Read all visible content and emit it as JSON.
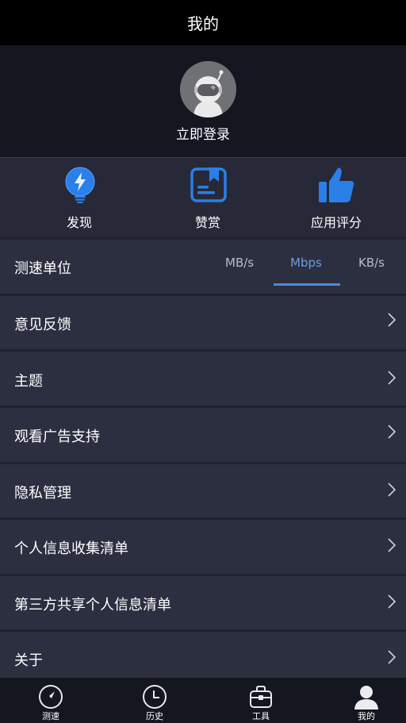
{
  "header": {
    "title": "我的"
  },
  "profile": {
    "login_label": "立即登录"
  },
  "shortcuts": [
    {
      "label": "发现",
      "icon": "lightbulb-icon"
    },
    {
      "label": "赞赏",
      "icon": "reward-book-icon"
    },
    {
      "label": "应用评分",
      "icon": "thumbs-up-icon"
    }
  ],
  "speed_unit": {
    "label": "测速单位",
    "options": [
      "MB/s",
      "Mbps",
      "KB/s"
    ],
    "selected": "Mbps"
  },
  "menu": [
    {
      "label": "意见反馈"
    },
    {
      "label": "主题"
    },
    {
      "label": "观看广告支持"
    },
    {
      "label": "隐私管理"
    },
    {
      "label": "个人信息收集清单"
    },
    {
      "label": "第三方共享个人信息清单"
    },
    {
      "label": "关于"
    }
  ],
  "bottom_nav": [
    {
      "label": "测速",
      "icon": "speedometer-icon"
    },
    {
      "label": "历史",
      "icon": "clock-icon"
    },
    {
      "label": "工具",
      "icon": "toolbox-icon"
    },
    {
      "label": "我的",
      "icon": "user-icon",
      "active": true
    }
  ],
  "colors": {
    "accent": "#2a7fe8",
    "active_text": "#6f9bdc",
    "background": "#20222f",
    "row": "#2c2f40"
  }
}
